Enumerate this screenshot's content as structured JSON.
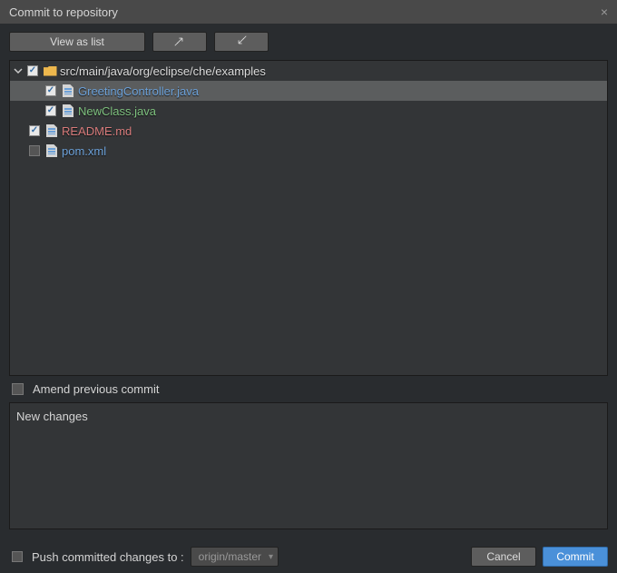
{
  "dialog": {
    "title": "Commit to repository"
  },
  "toolbar": {
    "view_as_list": "View as list"
  },
  "tree": {
    "root": {
      "path": "src/main/java/org/eclipse/che/examples"
    },
    "files": [
      {
        "name": "GreetingController.java",
        "status": "modified",
        "checked": true,
        "selected": true
      },
      {
        "name": "NewClass.java",
        "status": "new",
        "checked": true,
        "selected": false
      }
    ],
    "root_files": [
      {
        "name": "README.md",
        "status": "removed",
        "checked": true
      },
      {
        "name": "pom.xml",
        "status": "modified",
        "checked": false
      }
    ]
  },
  "amend": {
    "label": "Amend previous commit",
    "checked": false
  },
  "commit_message": "New changes",
  "push": {
    "label": "Push committed changes to :",
    "remote": "origin/master",
    "checked": false
  },
  "buttons": {
    "cancel": "Cancel",
    "commit": "Commit"
  }
}
